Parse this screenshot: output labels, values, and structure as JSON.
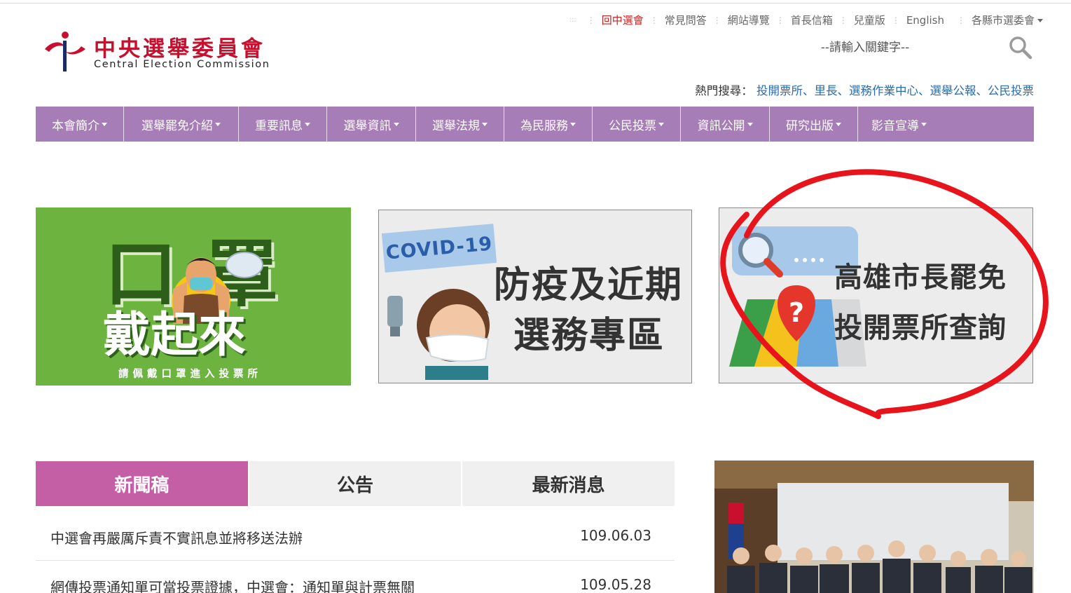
{
  "top_links": {
    "items": [
      {
        "label": "回中選會",
        "highlight": true
      },
      {
        "label": "常見問答"
      },
      {
        "label": "網站導覽"
      },
      {
        "label": "首長信箱"
      },
      {
        "label": "兒童版"
      },
      {
        "label": "English"
      }
    ],
    "dropdown_label": "各縣市選委會"
  },
  "logo": {
    "title": "中央選舉委員會",
    "subtitle": "Central Election Commission"
  },
  "search": {
    "placeholder": "--請輸入關鍵字--",
    "icon": "search-icon"
  },
  "hot_search": {
    "label": "熱門搜尋：",
    "items": [
      "投開票所",
      "里長",
      "選務作業中心",
      "選舉公報",
      "公民投票"
    ]
  },
  "nav": {
    "items": [
      "本會簡介",
      "選舉罷免介紹",
      "重要訊息",
      "選舉資訊",
      "選舉法規",
      "為民服務",
      "公民投票",
      "資訊公開",
      "研究出版",
      "影音宣導"
    ]
  },
  "banners": {
    "mask": {
      "line1_a": "口",
      "line1_b": "罩",
      "line2": "戴起來",
      "caption": "請佩戴口罩進入投票所"
    },
    "covid": {
      "tag": "COVID-19",
      "line1": "防疫及近期",
      "line2": "選務專區"
    },
    "recall": {
      "line1": "高雄市長罷免",
      "line2": "投開票所查詢"
    }
  },
  "news_tabs": {
    "tabs": [
      "新聞稿",
      "公告",
      "最新消息"
    ],
    "active": 0,
    "rows": [
      {
        "title": "中選會再嚴厲斥責不實訊息並將移送法辦",
        "date": "109.06.03"
      },
      {
        "title": "網傳投票通知單可當投票證據，中選會：通知單與計票無關",
        "date": "109.05.28"
      }
    ]
  },
  "colors": {
    "nav_bg": "#a67db6",
    "tab_active": "#c45fa6",
    "brand_red": "#c8102e",
    "link_blue": "#2a6cb0",
    "banner_green": "#6db33f",
    "annotation_red": "#e8141b"
  }
}
